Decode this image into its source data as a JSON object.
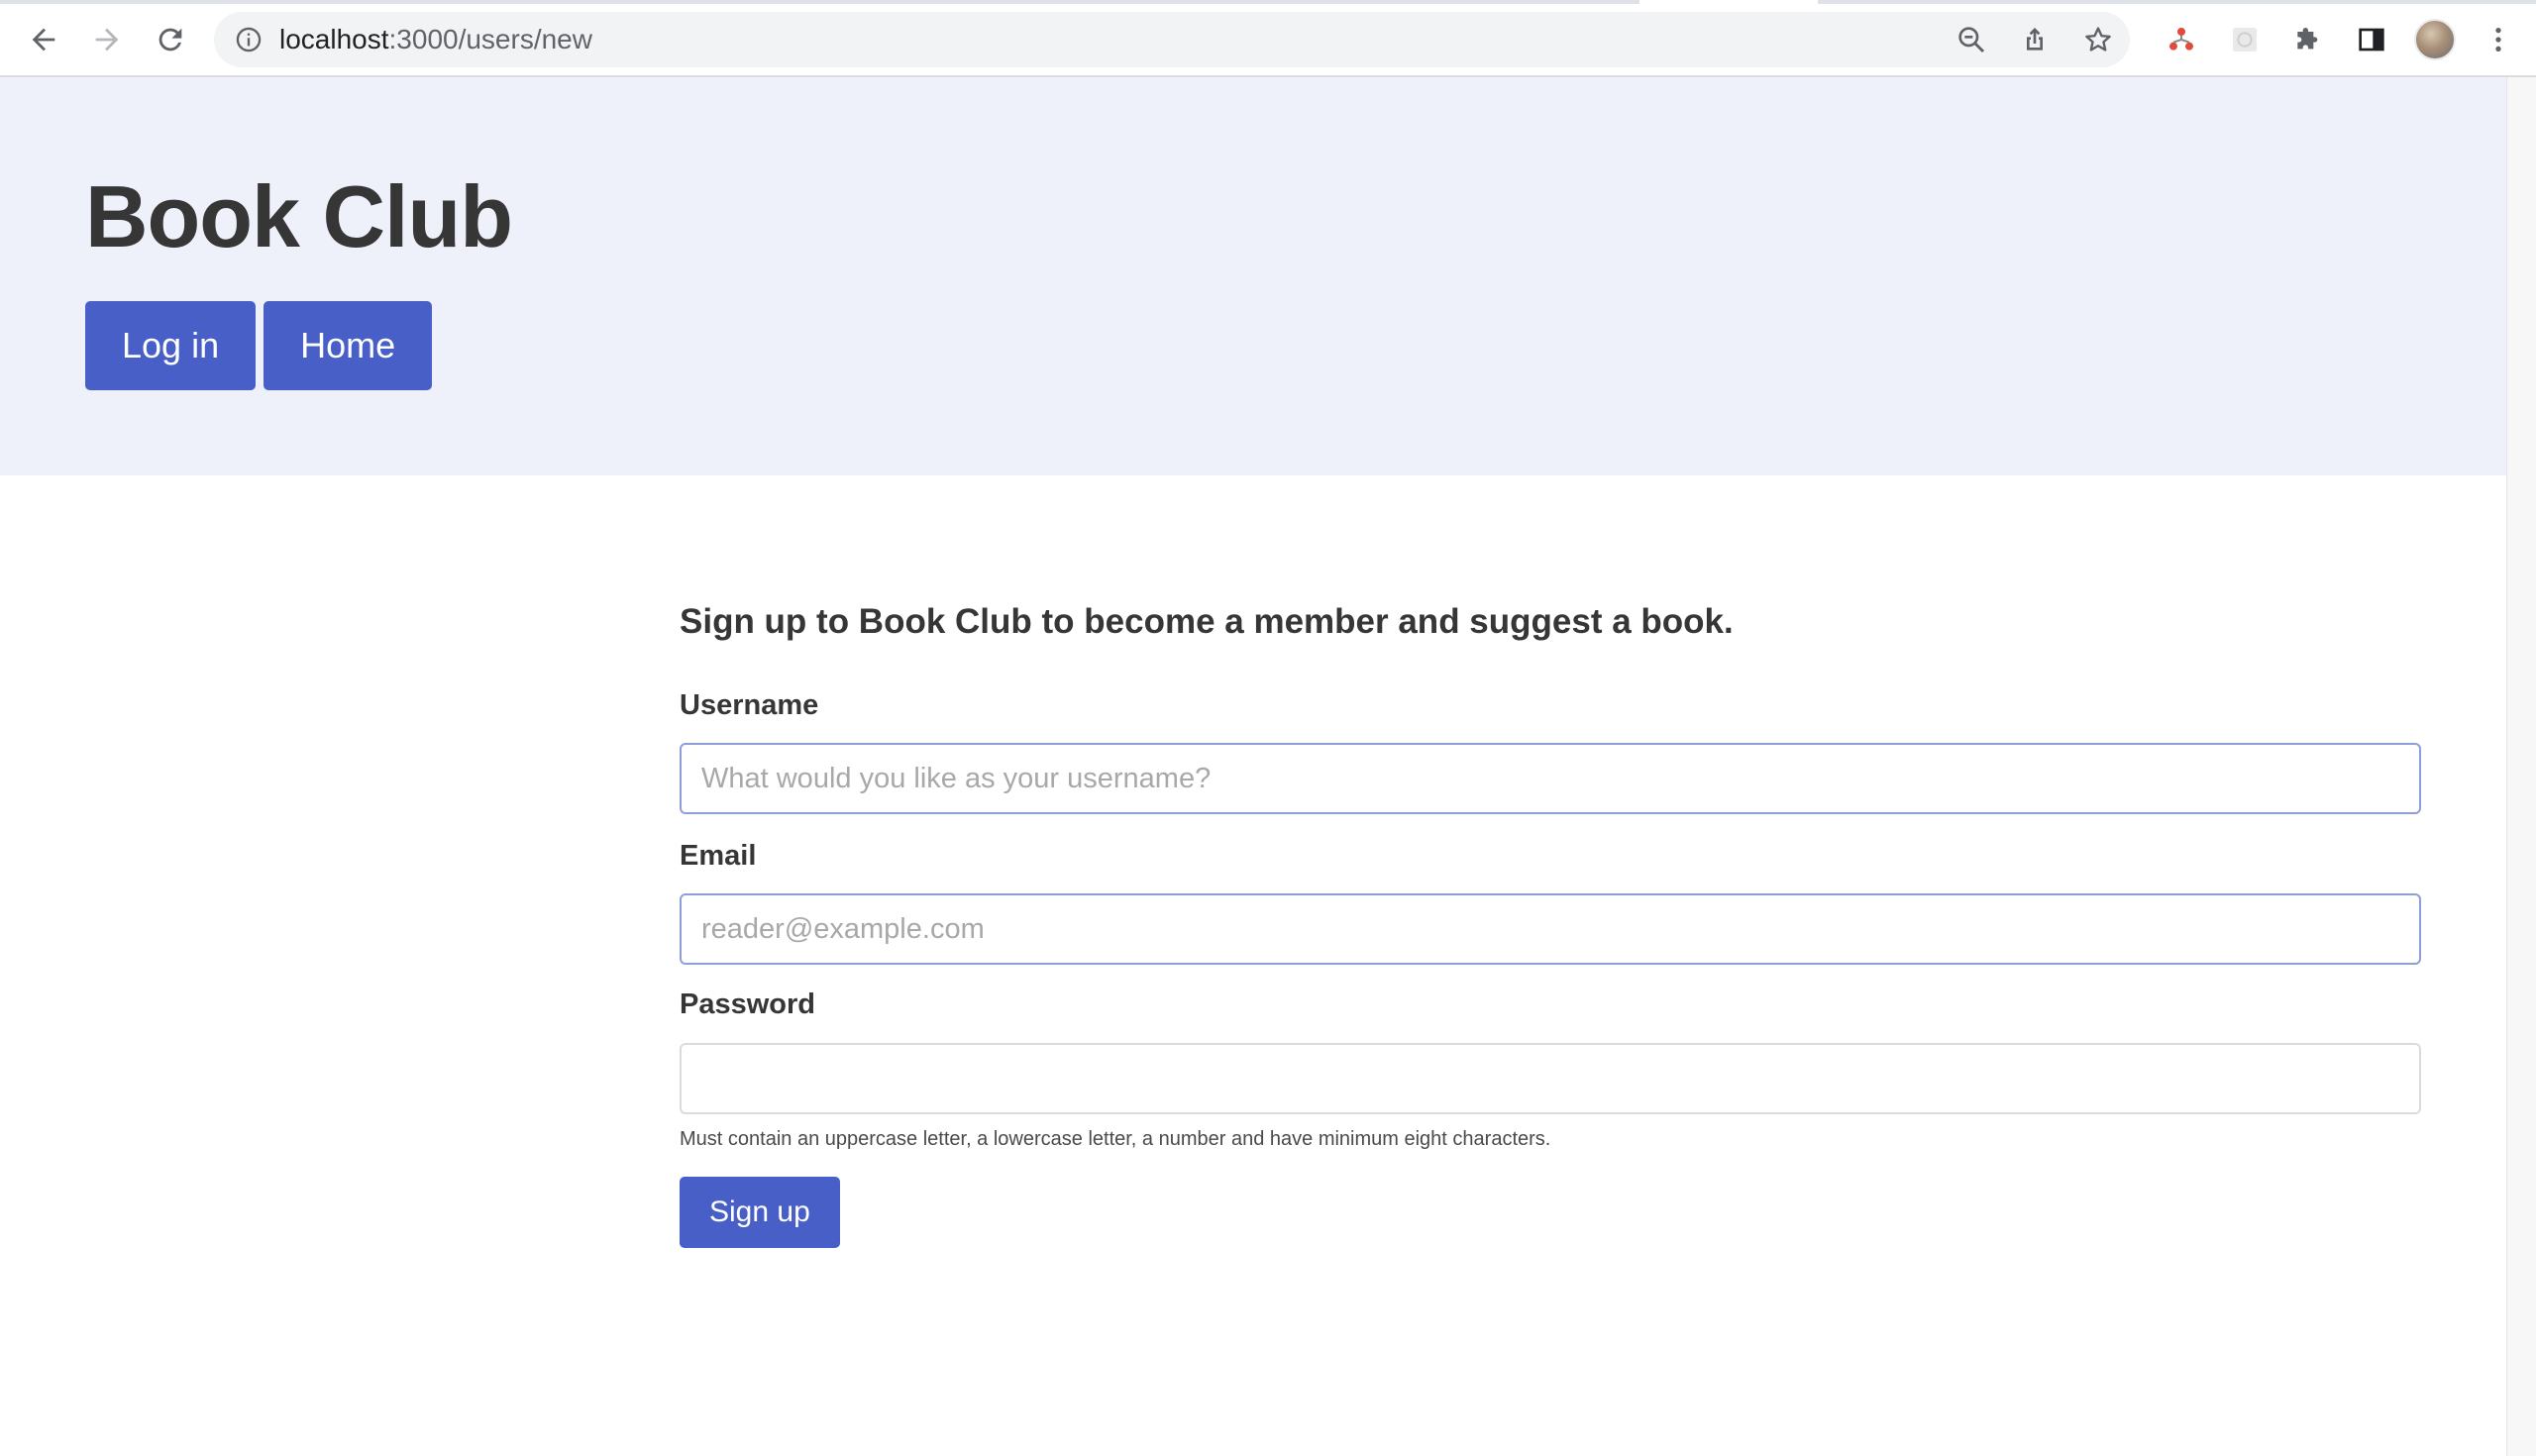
{
  "browser": {
    "url_host": "localhost",
    "url_path": ":3000/users/new"
  },
  "header": {
    "title": "Book Club",
    "nav": [
      {
        "label": "Log in"
      },
      {
        "label": "Home"
      }
    ]
  },
  "form": {
    "intro": "Sign up to Book Club to become a member and suggest a book.",
    "username_label": "Username",
    "username_placeholder": "What would you like as your username?",
    "username_value": "",
    "email_label": "Email",
    "email_placeholder": "reader@example.com",
    "email_value": "",
    "password_label": "Password",
    "password_value": "",
    "password_help": "Must contain an uppercase letter, a lowercase letter, a number and have minimum eight characters.",
    "submit_label": "Sign up"
  },
  "colors": {
    "primary": "#485fc7",
    "hero_bg": "#eef1fa",
    "text": "#363636"
  }
}
